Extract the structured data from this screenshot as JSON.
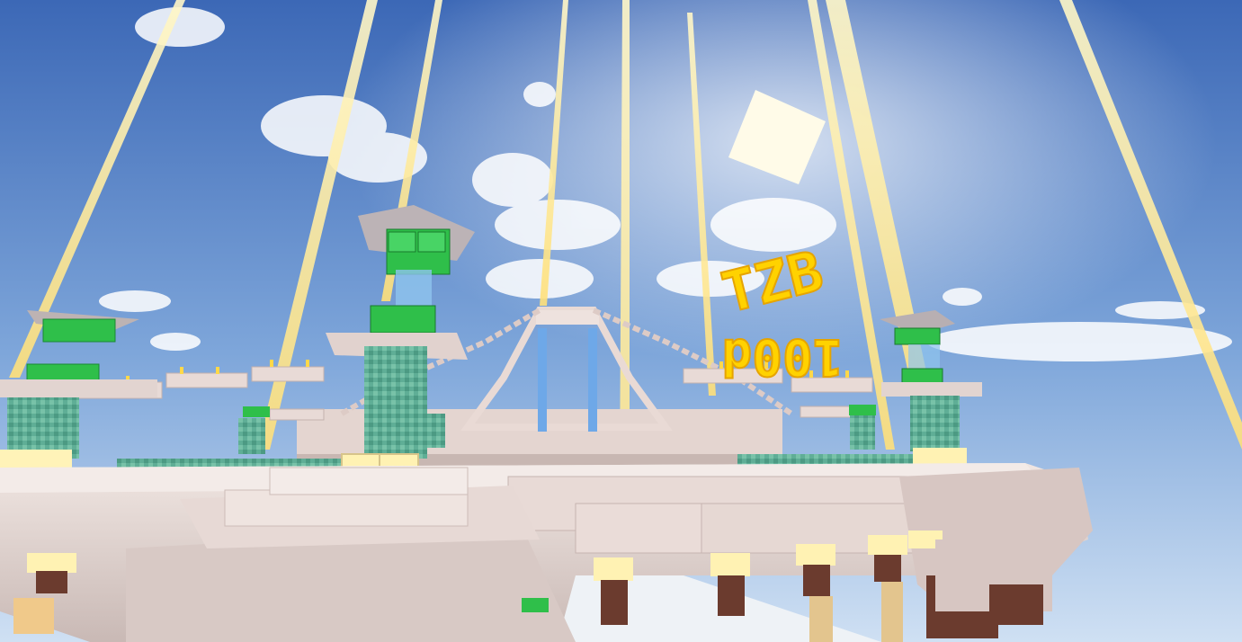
{
  "scene": {
    "type": "minecraft-skywars-map",
    "sign": {
      "line1": "TZB",
      "line2": "100d"
    },
    "colors": {
      "sky_top": "#3f6fbf",
      "sky_bottom": "#bfd6ef",
      "sun": "#fffbe6",
      "beam": "#ffe98a",
      "quartz": "#e6d8d2",
      "quartz_shadow": "#b9a8a4",
      "prismarine": "#4fa88e",
      "emerald": "#2fbf4a",
      "glowstone": "#fff2b3",
      "sign_text": "#ffd200",
      "glass": "#8fc4ee"
    }
  }
}
